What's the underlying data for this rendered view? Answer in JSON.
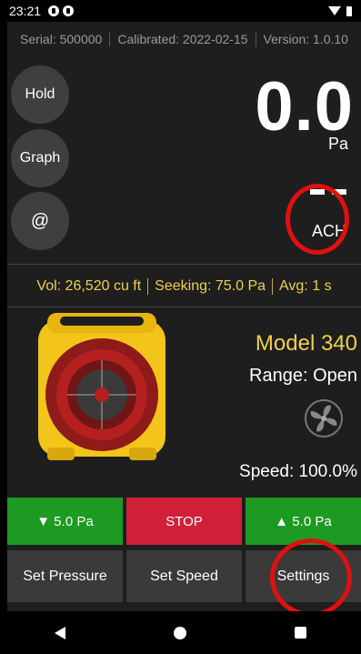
{
  "statusbar": {
    "time": "23:21"
  },
  "info": {
    "serial": "Serial: 500000",
    "calibrated": "Calibrated: 2022-02-15",
    "version": "Version: 1.0.10"
  },
  "side_buttons": {
    "hold": "Hold",
    "graph": "Graph",
    "at": "@"
  },
  "reading": {
    "value": "0.0",
    "unit": "Pa",
    "ach_value": "- -",
    "ach_label": "ACH"
  },
  "summary": {
    "vol": "Vol: 26,520 cu ft",
    "seeking": "Seeking: 75.0 Pa",
    "avg": "Avg: 1 s"
  },
  "device": {
    "model": "Model 340",
    "range": "Range: Open",
    "speed": "Speed: 100.0%"
  },
  "controls": {
    "down": "▼ 5.0 Pa",
    "stop": "STOP",
    "up": "▲ 5.0 Pa"
  },
  "settings_row": {
    "set_pressure": "Set Pressure",
    "set_speed": "Set Speed",
    "settings": "Settings"
  },
  "colors": {
    "accent_yellow": "#f0d048",
    "green": "#1d9a22",
    "red": "#d0203a",
    "highlight": "#e01010"
  }
}
